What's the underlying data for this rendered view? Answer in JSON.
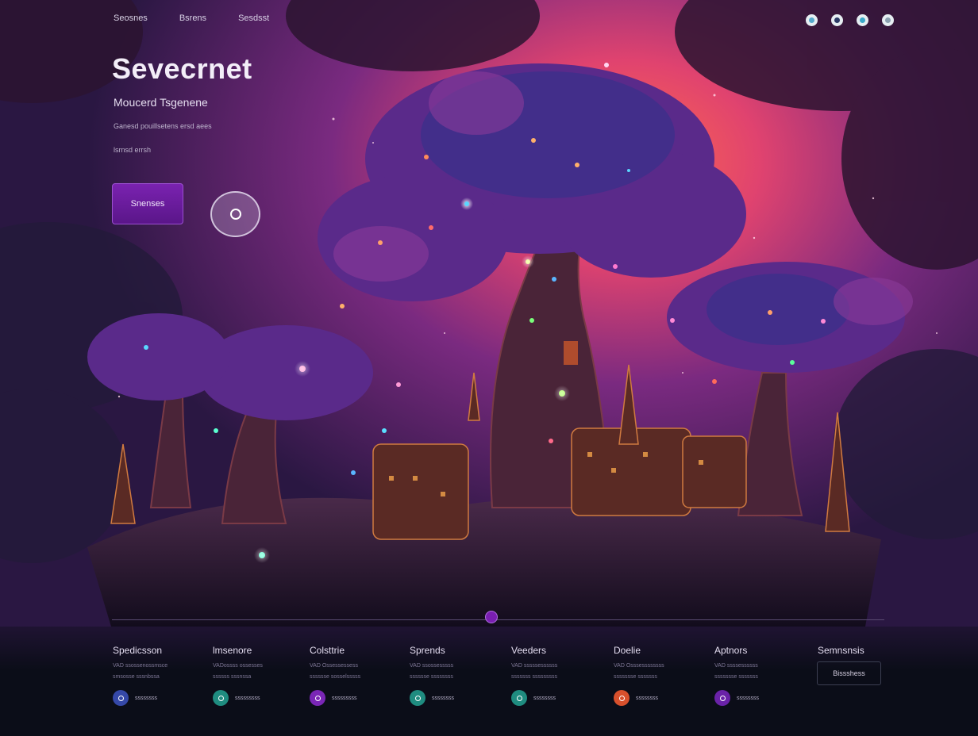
{
  "nav": {
    "items": [
      "Seosnes",
      "Bsrens",
      "Sesdsst"
    ]
  },
  "header_icons": [
    "camera-icon",
    "location-icon",
    "globe-icon",
    "settings-icon"
  ],
  "hero": {
    "title": "Sevecrnet",
    "subtitle": "Moucerd Tsgenene",
    "line1": "Ganesd pouillsetens ersd aees",
    "line2": "lsrnsd errsh",
    "cta_label": "Snenses"
  },
  "columns": [
    {
      "heading": "Spedicsson",
      "line1": "VAD ssossenossmsce",
      "line2": "smsosse sssnbssa",
      "badge": "ssssssss",
      "color": "#3548a8"
    },
    {
      "heading": "lmsenore",
      "line1": "VADossss ossesses",
      "line2": "ssssss sssnssa",
      "badge": "sssssssss",
      "color": "#1f8c80"
    },
    {
      "heading": "Colsttrie",
      "line1": "VAD Ossessessess",
      "line2": "sssssse sosselsssss",
      "badge": "sssssssss",
      "color": "#7a26b6"
    },
    {
      "heading": "Sprends",
      "line1": "VAD ssossesssss",
      "line2": "sssssse ssssssss",
      "badge": "ssssssss",
      "color": "#1f8c80"
    },
    {
      "heading": "Veeders",
      "line1": "VAD sssssessssss",
      "line2": "sssssss sssssssss",
      "badge": "ssssssss",
      "color": "#1f8c80"
    },
    {
      "heading": "Doelie",
      "line1": "VAD Osssessssssss",
      "line2": "ssssssse sssssss",
      "badge": "ssssssss",
      "color": "#d8502c"
    },
    {
      "heading": "Aptnors",
      "line1": "VAD ssssessssss",
      "line2": "ssssssse sssssss",
      "badge": "ssssssss",
      "color": "#6a22a8"
    },
    {
      "heading": "Semnsnsis",
      "line1": "",
      "line2": "",
      "badge": "",
      "color": ""
    }
  ],
  "footer_button": "Bissshess",
  "colors": {
    "accent": "#7a22b0",
    "teal": "#1f8c80",
    "navy": "#3548a8",
    "orange": "#d8502c"
  }
}
